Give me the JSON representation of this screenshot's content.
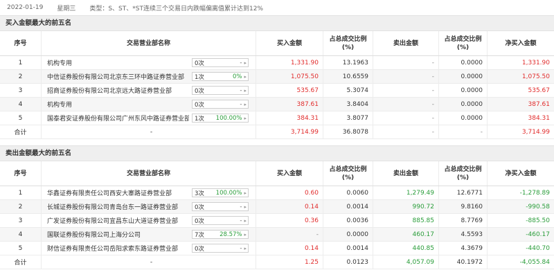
{
  "info": {
    "date": "2022-01-19",
    "weekday": "星期三",
    "type": "类型：S、ST、*ST连续三个交易日内跌幅偏离值累计达到12%"
  },
  "headers": {
    "idx": "序号",
    "name": "交易营业部名称",
    "buy": "买入金额",
    "buy_pct": "占总成交比例(%)",
    "sell": "卖出金额",
    "sell_pct": "占总成交比例(%)",
    "net": "净买入金额"
  },
  "buy_section": {
    "title": "买入金额最大的前五名",
    "rows": [
      {
        "idx": "1",
        "name": "机构专用",
        "times": "0次",
        "pct": "-",
        "buy": "1,331.90",
        "buy_pct": "13.1963",
        "sell": "-",
        "sell_pct": "0.0000",
        "net": "1,331.90"
      },
      {
        "idx": "2",
        "name": "中信证券股份有限公司北京东三环中路证券营业部",
        "times": "1次",
        "pct": "0%",
        "buy": "1,075.50",
        "buy_pct": "10.6559",
        "sell": "-",
        "sell_pct": "0.0000",
        "net": "1,075.50"
      },
      {
        "idx": "3",
        "name": "招商证券股份有限公司北京远大路证券营业部",
        "times": "0次",
        "pct": "-",
        "buy": "535.67",
        "buy_pct": "5.3074",
        "sell": "-",
        "sell_pct": "0.0000",
        "net": "535.67"
      },
      {
        "idx": "4",
        "name": "机构专用",
        "times": "0次",
        "pct": "-",
        "buy": "387.61",
        "buy_pct": "3.8404",
        "sell": "-",
        "sell_pct": "0.0000",
        "net": "387.61"
      },
      {
        "idx": "5",
        "name": "国泰君安证券股份有限公司广州东风中路证券营业部",
        "times": "1次",
        "pct": "100.00%",
        "buy": "384.31",
        "buy_pct": "3.8077",
        "sell": "-",
        "sell_pct": "0.0000",
        "net": "384.31"
      }
    ],
    "total": {
      "label": "合计",
      "name": "-",
      "buy": "3,714.99",
      "buy_pct": "36.8078",
      "sell": "-",
      "sell_pct": "-",
      "net": "3,714.99"
    }
  },
  "sell_section": {
    "title": "卖出金额最大的前五名",
    "rows": [
      {
        "idx": "1",
        "name": "华鑫证券有限责任公司西安大寨路证券营业部",
        "times": "3次",
        "pct": "100.00%",
        "buy": "0.60",
        "buy_pct": "0.0060",
        "sell": "1,279.49",
        "sell_pct": "12.6771",
        "net": "-1,278.89"
      },
      {
        "idx": "2",
        "name": "长城证券股份有限公司青岛台东一路证券营业部",
        "times": "0次",
        "pct": "-",
        "buy": "0.14",
        "buy_pct": "0.0014",
        "sell": "990.72",
        "sell_pct": "9.8160",
        "net": "-990.58"
      },
      {
        "idx": "3",
        "name": "广发证券股份有限公司宜昌东山大道证券营业部",
        "times": "0次",
        "pct": "-",
        "buy": "0.36",
        "buy_pct": "0.0036",
        "sell": "885.85",
        "sell_pct": "8.7769",
        "net": "-885.50"
      },
      {
        "idx": "4",
        "name": "国联证券股份有限公司上海分公司",
        "times": "7次",
        "pct": "28.57%",
        "buy": "-",
        "buy_pct": "0.0000",
        "sell": "460.17",
        "sell_pct": "4.5593",
        "net": "-460.17"
      },
      {
        "idx": "5",
        "name": "财信证券有限责任公司岳阳求索东路证券营业部",
        "times": "0次",
        "pct": "-",
        "buy": "0.14",
        "buy_pct": "0.0014",
        "sell": "440.85",
        "sell_pct": "4.3679",
        "net": "-440.70"
      }
    ],
    "total": {
      "label": "合计",
      "name": "-",
      "buy": "1.25",
      "buy_pct": "0.0123",
      "sell": "4,057.09",
      "sell_pct": "40.1972",
      "net": "-4,055.84"
    }
  },
  "colors": {
    "up": "#e12b2b",
    "down": "#2a9d3a",
    "header_bg": "#efefef"
  },
  "icons": {
    "dropdown": "caret-right-icon"
  }
}
